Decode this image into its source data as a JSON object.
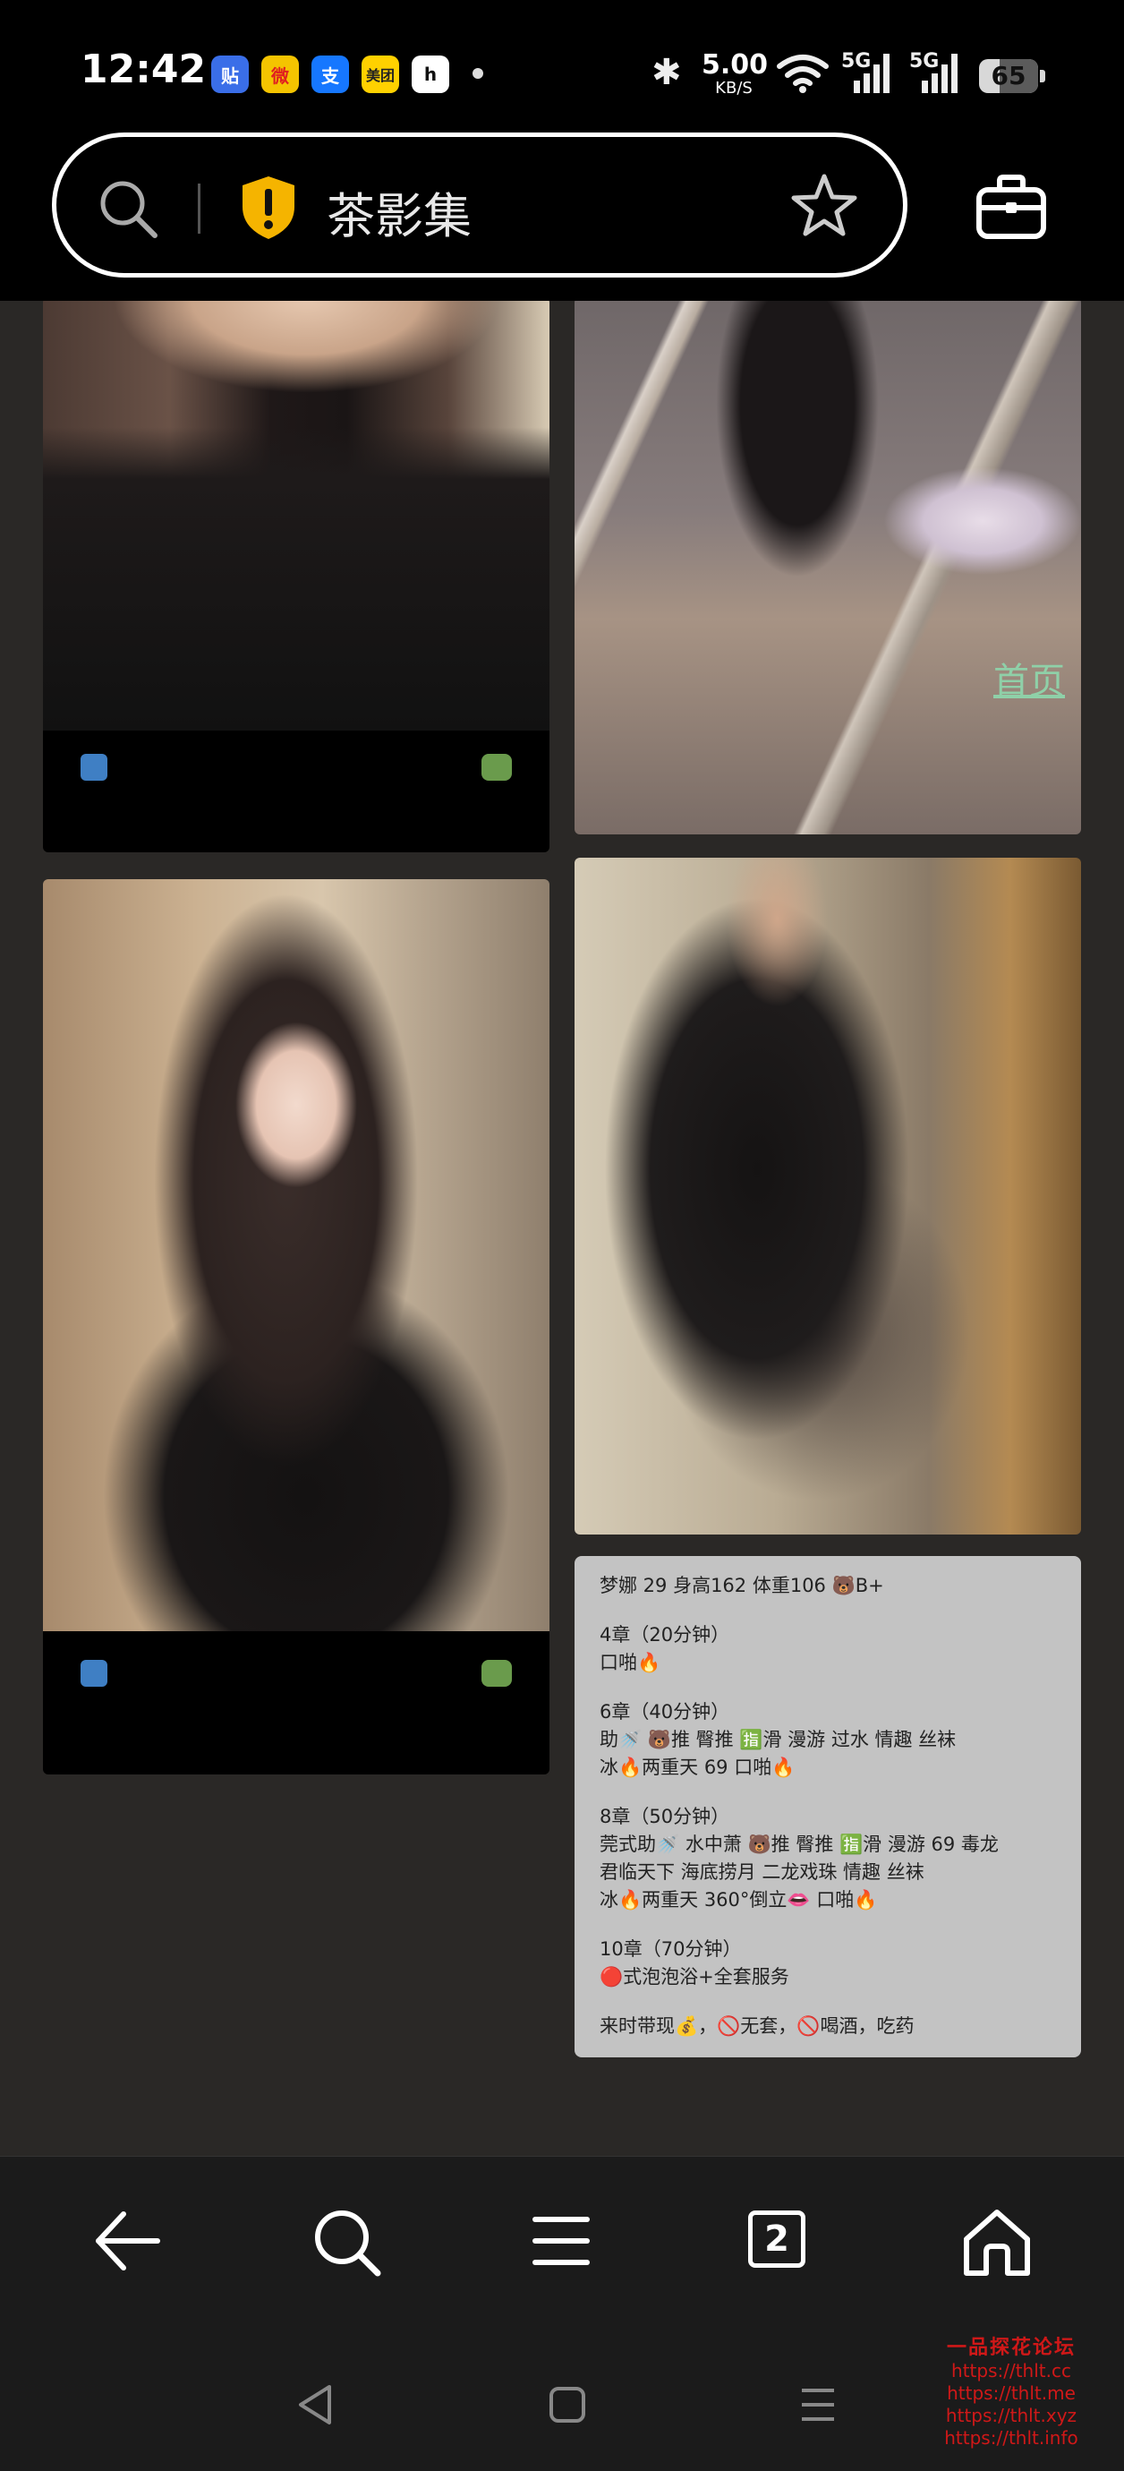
{
  "status": {
    "time": "12:42",
    "apps": [
      {
        "icon": "tieba-icon",
        "text": "贴",
        "bg": "#3a6ee8",
        "fg": "#ffffff"
      },
      {
        "icon": "weibo-icon",
        "text": "微",
        "bg": "#f4c400",
        "fg": "#e02020"
      },
      {
        "icon": "alipay-icon",
        "text": "支",
        "bg": "#1677ff",
        "fg": "#ffffff"
      },
      {
        "icon": "meituan-icon",
        "text": "美团",
        "bg": "#ffd100",
        "fg": "#222222"
      },
      {
        "icon": "app-icon",
        "text": "h",
        "bg": "#ffffff",
        "fg": "#111111"
      }
    ],
    "network_speed": "5.00",
    "network_speed_unit": "KB/S",
    "network_1": "5G",
    "network_2": "5G",
    "battery": "65"
  },
  "browser": {
    "page_title": "茶影集",
    "site_warning_icon": "shield-warning-icon"
  },
  "content": {
    "home_link": "首页",
    "info": {
      "header": "梦娜 29 身高162 体重106 🐻B+",
      "sections": [
        {
          "title": "4章（20分钟）",
          "lines": [
            "口啪🔥"
          ]
        },
        {
          "title": "6章（40分钟）",
          "lines": [
            "助🚿 🐻推 臀推 🈯滑 漫游 过水 情趣 丝袜",
            "冰🔥两重天  69  口啪🔥"
          ]
        },
        {
          "title": "8章（50分钟）",
          "lines": [
            "莞式助🚿 水中萧 🐻推 臀推 🈯滑 漫游 69 毒龙",
            "君临天下 海底捞月 二龙戏珠 情趣 丝袜",
            "冰🔥两重天 360°倒立👄 口啪🔥"
          ]
        },
        {
          "title": "10章（70分钟）",
          "lines": [
            "🔴式泡泡浴+全套服务"
          ]
        },
        {
          "title": "",
          "lines": [
            "来时带现💰，🚫无套，🚫喝酒，吃药"
          ]
        }
      ]
    }
  },
  "nav": {
    "tab_count": "2"
  },
  "watermark": {
    "title": "一品探花论坛",
    "urls": [
      "https://thlt.cc",
      "https://thlt.me",
      "https://thlt.xyz",
      "https://thlt.info"
    ]
  },
  "colors": {
    "background": "#2a2826",
    "bars": "#000000",
    "nav": "#1b1b1b",
    "info_card": "#c3c3c3",
    "shield": "#f5b400",
    "watermark": "#d01818"
  }
}
